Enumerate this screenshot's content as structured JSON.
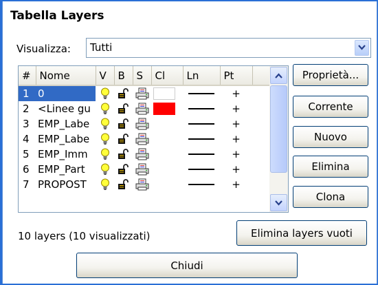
{
  "window": {
    "title": "Tabella Layers"
  },
  "filter": {
    "label": "Visualizza:",
    "value": "Tutti"
  },
  "columns": [
    "#",
    "Nome",
    "V",
    "B",
    "S",
    "Cl",
    "Ln",
    "Pt"
  ],
  "rows": [
    {
      "num": "1",
      "name": "0",
      "color": "#ffffff",
      "pt": "+",
      "selected": true
    },
    {
      "num": "2",
      "name": "<Linee gu",
      "color": "#ff0000",
      "pt": "+",
      "selected": false
    },
    {
      "num": "3",
      "name": "EMP_Labe",
      "color": "",
      "pt": "+",
      "selected": false
    },
    {
      "num": "4",
      "name": "EMP_Labe",
      "color": "",
      "pt": "+",
      "selected": false
    },
    {
      "num": "5",
      "name": "EMP_Imm",
      "color": "",
      "pt": "+",
      "selected": false
    },
    {
      "num": "6",
      "name": "EMP_Part",
      "color": "",
      "pt": "+",
      "selected": false
    },
    {
      "num": "7",
      "name": "PROPOST",
      "color": "",
      "pt": "+",
      "selected": false
    }
  ],
  "icons": {
    "visible": "bulb-icon",
    "lock": "open-lock-icon",
    "print": "printer-icon"
  },
  "buttons": {
    "properties": "Proprietà...",
    "current": "Corrente",
    "new": "Nuovo",
    "delete": "Elimina",
    "clone": "Clona",
    "delete_empty": "Elimina layers vuoti",
    "close": "Chiudi"
  },
  "status": "10 layers (10 visualizzati)",
  "colors": {
    "selection": "#316ac5",
    "accent": "#003c74"
  }
}
